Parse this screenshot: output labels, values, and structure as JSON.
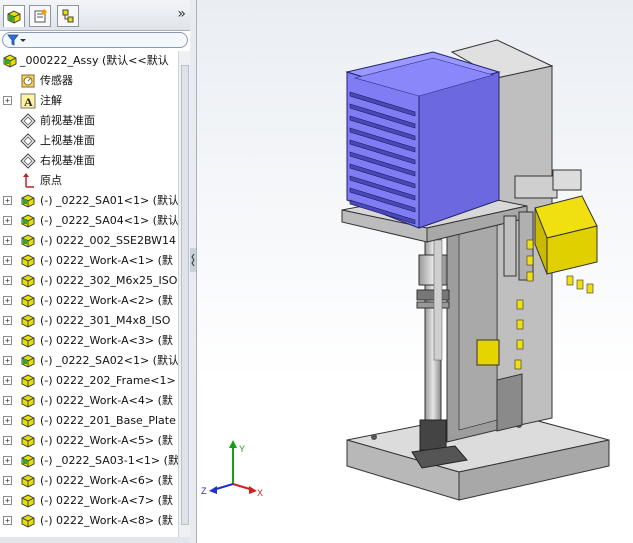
{
  "panel": {
    "tabs": [
      "feature-manager",
      "property-manager",
      "configuration-manager"
    ],
    "collapse_glyph": "»",
    "filter_icon": "funnel-icon"
  },
  "tree": {
    "root": "_000222_Assy  (默认<<默认",
    "items": [
      {
        "label": "传感器",
        "icon": "sensor-icon",
        "expand": false
      },
      {
        "label": "注解",
        "icon": "annotation-icon",
        "expand": true
      },
      {
        "label": "前视基准面",
        "icon": "plane-icon",
        "expand": false
      },
      {
        "label": "上视基准面",
        "icon": "plane-icon",
        "expand": false
      },
      {
        "label": "右视基准面",
        "icon": "plane-icon",
        "expand": false
      },
      {
        "label": "原点",
        "icon": "origin-icon",
        "expand": false
      },
      {
        "label": "(-) _0222_SA01<1> (默认",
        "icon": "subassembly-icon",
        "expand": true
      },
      {
        "label": "(-) _0222_SA04<1> (默认",
        "icon": "subassembly-icon",
        "expand": true
      },
      {
        "label": "(-) 0222_002_SSE2BW14",
        "icon": "subassembly-icon",
        "expand": true
      },
      {
        "label": "(-) 0222_Work-A<1> (默",
        "icon": "part-icon",
        "expand": true
      },
      {
        "label": "(-) 0222_302_M6x25_ISO",
        "icon": "part-icon",
        "expand": true
      },
      {
        "label": "(-) 0222_Work-A<2> (默",
        "icon": "part-icon",
        "expand": true
      },
      {
        "label": "(-) 0222_301_M4x8_ISO",
        "icon": "part-icon",
        "expand": true
      },
      {
        "label": "(-) 0222_Work-A<3> (默",
        "icon": "part-icon",
        "expand": true
      },
      {
        "label": "(-) _0222_SA02<1> (默认",
        "icon": "subassembly-icon",
        "expand": true
      },
      {
        "label": "(-) 0222_202_Frame<1>",
        "icon": "part-icon",
        "expand": true
      },
      {
        "label": "(-) 0222_Work-A<4> (默",
        "icon": "part-icon",
        "expand": true
      },
      {
        "label": "(-) 0222_201_Base_Plate",
        "icon": "part-icon",
        "expand": true
      },
      {
        "label": "(-) 0222_Work-A<5> (默",
        "icon": "part-icon",
        "expand": true
      },
      {
        "label": "(-) _0222_SA03-1<1> (默",
        "icon": "subassembly-icon",
        "expand": true
      },
      {
        "label": "(-) 0222_Work-A<6> (默",
        "icon": "part-icon",
        "expand": true
      },
      {
        "label": "(-) 0222_Work-A<7> (默",
        "icon": "part-icon",
        "expand": true
      },
      {
        "label": "(-) 0222_Work-A<8> (默",
        "icon": "part-icon",
        "expand": true
      }
    ]
  },
  "triad": {
    "x": "X",
    "y": "Y",
    "z": "Z"
  },
  "colors": {
    "magazine_fill": "#7f7cf4",
    "magazine_edge": "#24246a",
    "gripper_yellow": "#f0e012",
    "frame_gray": "#c8c8c8",
    "axis_x": "#d12020",
    "axis_y": "#14a014",
    "axis_z": "#2030c8"
  }
}
